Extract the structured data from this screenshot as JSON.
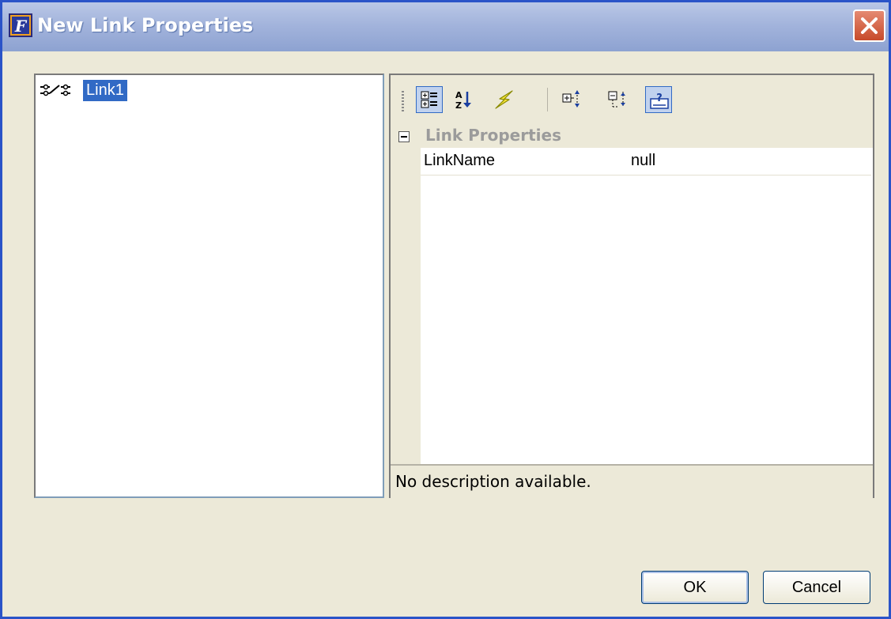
{
  "window": {
    "title": "New Link Properties"
  },
  "tree": {
    "items": [
      {
        "label": "Link1",
        "selected": true,
        "icon": "link-icon"
      }
    ]
  },
  "property_grid": {
    "toolbar": [
      {
        "name": "categorized-icon",
        "pressed": true
      },
      {
        "name": "sort-alphabetical-icon",
        "pressed": false
      },
      {
        "name": "events-lightning-icon",
        "pressed": false
      },
      {
        "name": "expand-all-icon",
        "pressed": false
      },
      {
        "name": "collapse-all-icon",
        "pressed": false
      },
      {
        "name": "help-description-icon",
        "pressed": true
      }
    ],
    "category": "Link Properties",
    "properties": [
      {
        "name": "LinkName",
        "value": "null"
      }
    ],
    "description": "No description available."
  },
  "buttons": {
    "ok": "OK",
    "cancel": "Cancel"
  },
  "colors": {
    "selection": "#316ac5",
    "titlebar": "#a3b4dc",
    "dialog_bg": "#ece9d8"
  }
}
